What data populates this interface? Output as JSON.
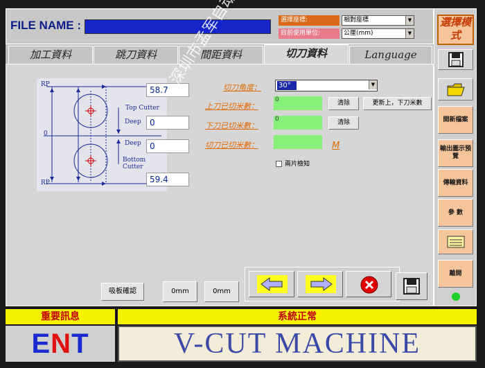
{
  "header": {
    "file_name_label": "FILE NAME :",
    "coord_label": "選擇座標:",
    "coord_value": "相對座標",
    "unit_label": "目前使用單位:",
    "unit_value": "公厘(mm)"
  },
  "tabs": [
    "加工資料",
    "跳刀資料",
    "間距資料",
    "切刀資料",
    "Language"
  ],
  "active_tab": "切刀資料",
  "diagram": {
    "rp_top": "RP",
    "zero": "0",
    "rp_bottom": "RP",
    "top_cutter": "Top Cutter",
    "deep1": "Deep",
    "deep2": "Deep",
    "bottom_cutter": "Bottom Cutter",
    "val_top": "58.7",
    "val_deep1": "0",
    "val_deep2": "0",
    "val_bottom": "59.4"
  },
  "cutter": {
    "angle_label": "切刀角度：",
    "angle_value": "30°",
    "upper_label": "上刀已切米數：",
    "upper_value": "0",
    "lower_label": "下刀已切米數：",
    "lower_value": "0",
    "total_label": "切刀已切米數：",
    "clear1": "清除",
    "clear2": "清除",
    "update_btn": "更新上，下刀米數",
    "unit_m": "M",
    "cracked_check": "兩片檢知"
  },
  "bottom_buttons": {
    "suction": "吸板確認",
    "zero1": "0mm",
    "zero2": "0mm"
  },
  "right": {
    "select_mode": "選擇模式",
    "new_file": "開新檔案",
    "output_preview": "輸出圖示預覽",
    "transfer": "傳輸資料",
    "params": "參 數",
    "leave": "離開"
  },
  "messages": {
    "left": "重要訊息",
    "right": "系統正常"
  },
  "logo": {
    "text": "ENT"
  },
  "banner": "V-CUT MACHINE",
  "watermark": "深圳市孟军自动化设备科技有限公司",
  "colors": {
    "accent_orange": "#e06a00",
    "green_field": "#88f07a",
    "yellow_bar": "#f7f200",
    "file_field_blue": "#1525c9"
  }
}
